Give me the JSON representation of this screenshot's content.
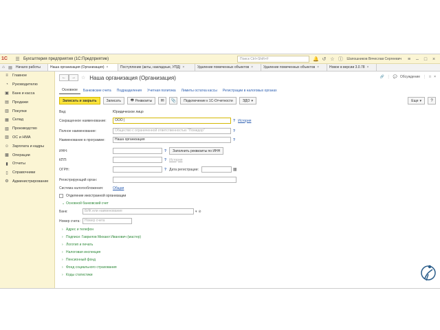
{
  "titlebar": {
    "app_title": "Бухгалтерия предприятия  (1С:Предприятие)",
    "search_placeholder": "Поиск Ctrl+Shift+F",
    "user_name": "Шапошников Вячеслав Сергеевич"
  },
  "tabs": [
    {
      "label": "Начало работы"
    },
    {
      "label": "Наша организация (Организация)"
    },
    {
      "label": "Поступление (акты, накладные, УПД)"
    },
    {
      "label": "Удаление помеченных объектов"
    },
    {
      "label": "Удаление помеченных объектов"
    },
    {
      "label": "Новое в версии 3.0.78"
    }
  ],
  "sidebar": {
    "items": [
      {
        "label": "Главное",
        "icon": "menu-icon"
      },
      {
        "label": "Руководителю",
        "icon": "chart-icon"
      },
      {
        "label": "Банк и касса",
        "icon": "bank-icon"
      },
      {
        "label": "Продажи",
        "icon": "cart-icon"
      },
      {
        "label": "Покупки",
        "icon": "basket-icon"
      },
      {
        "label": "Склад",
        "icon": "warehouse-icon"
      },
      {
        "label": "Производство",
        "icon": "factory-icon"
      },
      {
        "label": "ОС и НМА",
        "icon": "assets-icon"
      },
      {
        "label": "Зарплата и кадры",
        "icon": "people-icon"
      },
      {
        "label": "Операции",
        "icon": "operations-icon"
      },
      {
        "label": "Отчеты",
        "icon": "reports-icon"
      },
      {
        "label": "Справочники",
        "icon": "book-icon"
      },
      {
        "label": "Администрирование",
        "icon": "gear-icon"
      }
    ]
  },
  "form": {
    "title": "Наша организация (Организация)",
    "discussion": "Обсуждение",
    "subtabs": [
      {
        "label": "Основное"
      },
      {
        "label": "Банковские счета"
      },
      {
        "label": "Подразделения"
      },
      {
        "label": "Учетная политика"
      },
      {
        "label": "Лимиты остатка кассы"
      },
      {
        "label": "Регистрации в налоговых органах"
      }
    ],
    "buttons": {
      "save_close": "Записать и закрыть",
      "save": "Записать",
      "requisites": "Реквизиты",
      "connect": "Подключение к 1С-Отчетности",
      "edo": "ЭДО",
      "more": "Еще",
      "help": "?"
    },
    "fields": {
      "vid_label": "Вид:",
      "vid_value": "Юридическое лицо",
      "short_name_label": "Сокращенное наименование:",
      "short_name_value": "ООО |",
      "history": "История",
      "full_name_label": "Полное наименование:",
      "full_name_placeholder": "Общество с ограниченной ответственностью \"Помидор\"",
      "prog_name_label": "Наименование в программе:",
      "prog_name_value": "Наша организация",
      "inn_label": "ИНН:",
      "fill_by_inn": "Заполнить реквизиты по ИНН",
      "kpp_label": "КПП:",
      "history2": "История",
      "ogrn_label": "ОГРН:",
      "reg_date_label": "Дата регистрации:",
      "reg_org_label": "Регистрирующий орган:",
      "tax_system_label": "Система налогообложения:",
      "tax_system_value": "Общая",
      "foreign_branch": "Отделение иностранной организации",
      "bank_account_group": "Основной банковский счет",
      "bank_label": "Банк:",
      "bank_placeholder": "БИК или наименование",
      "account_label": "Номер счета:",
      "account_placeholder": "Номер счета"
    },
    "groups": [
      {
        "label": "Адрес и телефон"
      },
      {
        "label": "Подписи: Гаврилов Михаил Иванович (мастер)"
      },
      {
        "label": "Логотип и печать"
      },
      {
        "label": "Налоговая инспекция"
      },
      {
        "label": "Пенсионный фонд"
      },
      {
        "label": "Фонд социального страхования"
      },
      {
        "label": "Коды статистики"
      }
    ]
  },
  "colors": {
    "accent_yellow": "#fbe43c",
    "sidebar_bg": "#fbf5d4",
    "link_blue": "#2a5db0",
    "group_green": "#2f8a3a"
  }
}
